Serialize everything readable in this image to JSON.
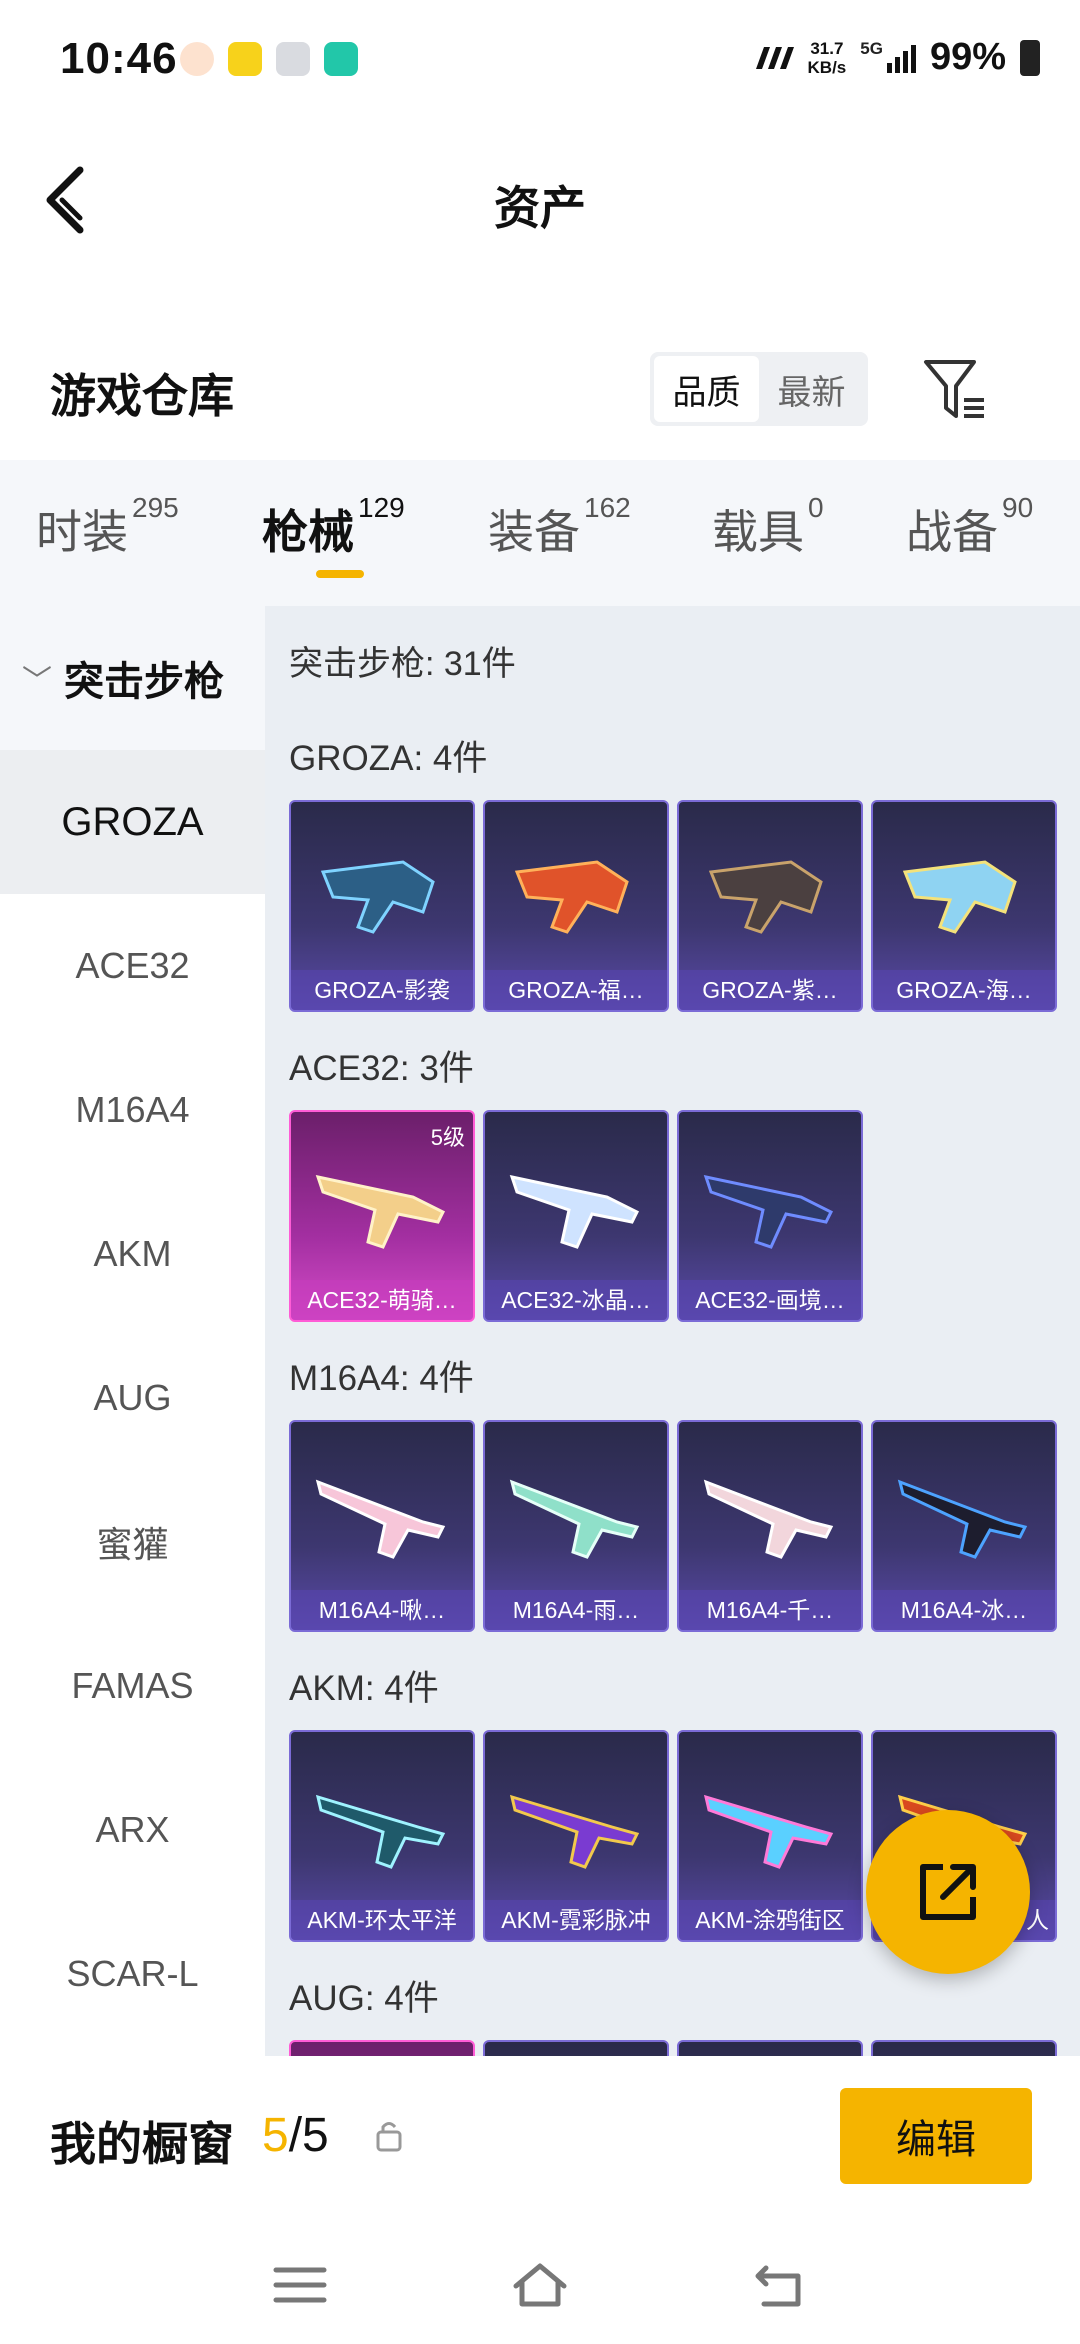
{
  "status_bar": {
    "time": "10:46",
    "speed_value": "31.7",
    "speed_unit": "KB/s",
    "network": "5G",
    "battery": "99%"
  },
  "header": {
    "title": "资产"
  },
  "warehouse": {
    "title": "游戏仓库",
    "sort_options": [
      "品质",
      "最新"
    ]
  },
  "tabs": [
    {
      "label": "时装",
      "count": "295"
    },
    {
      "label": "枪械",
      "count": "129"
    },
    {
      "label": "装备",
      "count": "162"
    },
    {
      "label": "载具",
      "count": "0"
    },
    {
      "label": "战备",
      "count": "90"
    }
  ],
  "sidebar": {
    "category": "突击步枪",
    "items": [
      "GROZA",
      "ACE32",
      "M16A4",
      "AKM",
      "AUG",
      "蜜獾",
      "FAMAS",
      "ARX",
      "SCAR-L"
    ]
  },
  "main": {
    "summary": "突击步枪: 31件",
    "groups": [
      {
        "title": "GROZA: 4件",
        "items": [
          "GROZA-影袭",
          "GROZA-福…",
          "GROZA-紫…",
          "GROZA-海…"
        ]
      },
      {
        "title": "ACE32: 3件",
        "items": [
          "ACE32-萌骑…",
          "ACE32-冰晶…",
          "ACE32-画境…"
        ],
        "level_badge": "5级"
      },
      {
        "title": "M16A4: 4件",
        "items": [
          "M16A4-啾…",
          "M16A4-雨…",
          "M16A4-千…",
          "M16A4-冰…"
        ]
      },
      {
        "title": "AKM: 4件",
        "items": [
          "AKM-环太平洋",
          "AKM-霓彩脉冲",
          "AKM-涂鸦街区",
          "人"
        ]
      },
      {
        "title": "AUG: 4件"
      }
    ]
  },
  "bottom_bar": {
    "label": "我的橱窗",
    "current": "5",
    "total": "/5",
    "edit_label": "编辑"
  },
  "colors": {
    "accent": "#f5b400",
    "card_purple": "#3d3770",
    "card_pink": "#a32fa1"
  }
}
